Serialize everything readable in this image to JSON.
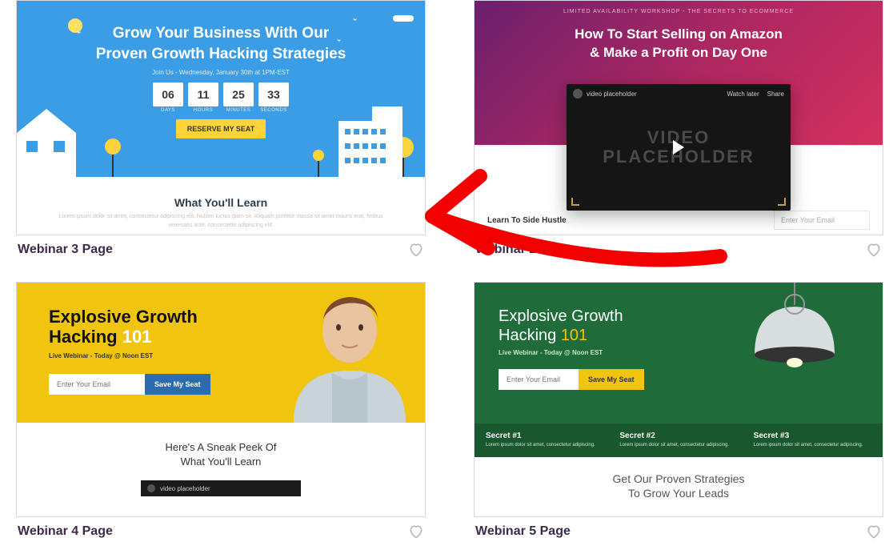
{
  "cards": [
    {
      "title": "Webinar 3 Page",
      "hero_line1": "Grow Your Business With Our",
      "hero_line2": "Proven Growth Hacking Strategies",
      "hero_sub": "Join Us - Wednesday, January 30th at 1PM-EST",
      "countdown": {
        "days": "06",
        "hours": "11",
        "minutes": "25",
        "seconds": "33"
      },
      "countdown_labels": {
        "days": "DAYS",
        "hours": "HOURS",
        "minutes": "MINUTES",
        "seconds": "SECONDS"
      },
      "cta": "RESERVE MY SEAT",
      "learn_title": "What You'll Learn",
      "learn_sub": "Lorem ipsum dolor sit amet, consectetur adipiscing elit. Nullam luctus diam sit. Aliquam porttitor massa sit amet mauris erat, finibus venenatis ante, consectetur adipiscing elit."
    },
    {
      "title": "Webinar 2 Page",
      "banner": "LIMITED AVAILABILITY WORKSHOP - THE SECRETS TO ECOMMERCE",
      "hero_line1": "How To Start Selling on Amazon",
      "hero_line2": "& Make a Profit on Day One",
      "video_label": "video placeholder",
      "watch_later": "Watch later",
      "share": "Share",
      "video_text1": "VIDEO",
      "video_text2": "PLACEHOLDER",
      "side_title": "Learn To Side Hustle",
      "email_placeholder": "Enter Your Email"
    },
    {
      "title": "Webinar 4 Page",
      "hero_text": "Explosive Growth",
      "hero_text2": "Hacking ",
      "hero_num": "101",
      "hero_sub": "Live Webinar - Today @ Noon EST",
      "email_placeholder": "Enter Your Email",
      "cta": "Save My Seat",
      "peek_line1": "Here's A Sneak Peek Of",
      "peek_line2": "What You'll Learn",
      "video_label": "video placeholder"
    },
    {
      "title": "Webinar 5 Page",
      "hero_text": "Explosive Growth",
      "hero_text2": "Hacking ",
      "hero_num": "101",
      "hero_sub": "Live Webinar - Today @ Noon EST",
      "email_placeholder": "Enter Your Email",
      "cta": "Save My Seat",
      "secrets": [
        {
          "h": "Secret #1",
          "t": "Lorem ipsum dolor sit amet, consectetur adipiscing."
        },
        {
          "h": "Secret #2",
          "t": "Lorem ipsum dolor sit amet, consectetur adipiscing."
        },
        {
          "h": "Secret #3",
          "t": "Lorem ipsum dolor sit amet, consectetur adipiscing."
        }
      ],
      "bottom_line1": "Get Our Proven Strategies",
      "bottom_line2": "To Grow Your Leads"
    }
  ]
}
